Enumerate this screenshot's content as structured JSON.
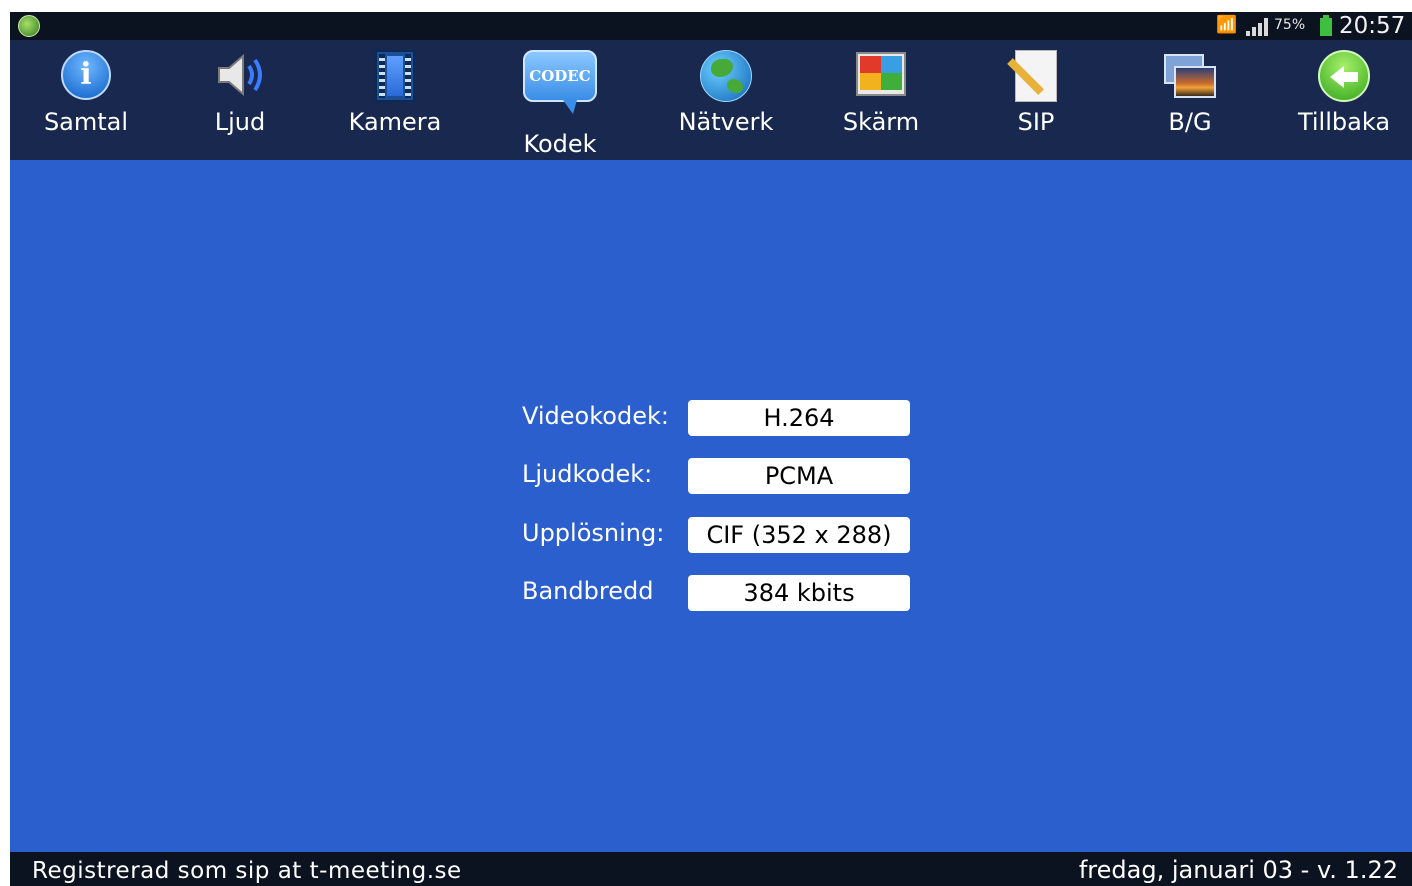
{
  "status_bar": {
    "app_icon": "t-meeting-app-icon",
    "battery_percent": "75%",
    "time": "20:57",
    "icons": [
      "wifi-icon",
      "signal-icon",
      "battery-icon"
    ]
  },
  "toolbar": {
    "items": [
      {
        "label": "Samtal",
        "icon": "info-icon"
      },
      {
        "label": "Ljud",
        "icon": "speaker-icon"
      },
      {
        "label": "Kamera",
        "icon": "film-icon"
      },
      {
        "label": "Kodek",
        "icon": "codec-icon",
        "icon_text": "CODEC",
        "selected": true
      },
      {
        "label": "Nätverk",
        "icon": "globe-icon"
      },
      {
        "label": "Skärm",
        "icon": "screen-icon"
      },
      {
        "label": "SIP",
        "icon": "document-icon"
      },
      {
        "label": "B/G",
        "icon": "image-icon"
      },
      {
        "label": "Tillbaka",
        "icon": "back-arrow-icon"
      }
    ]
  },
  "codec_settings": {
    "video_codec": {
      "label": "Videokodek:",
      "value": "H.264"
    },
    "audio_codec": {
      "label": "Ljudkodek:",
      "value": "PCMA"
    },
    "resolution": {
      "label": "Upplösning:",
      "value": "CIF (352 x 288)"
    },
    "bandwidth": {
      "label": "Bandbredd",
      "value": "384 kbits"
    }
  },
  "footer": {
    "registration": "Registrerad som sip at t-meeting.se",
    "date_version": "fredag, januari 03 - v. 1.22"
  },
  "colors": {
    "background": "#2b5fcd",
    "toolbar": "#18284e",
    "status_bar": "#0c1320",
    "field_background": "#ffffff"
  }
}
